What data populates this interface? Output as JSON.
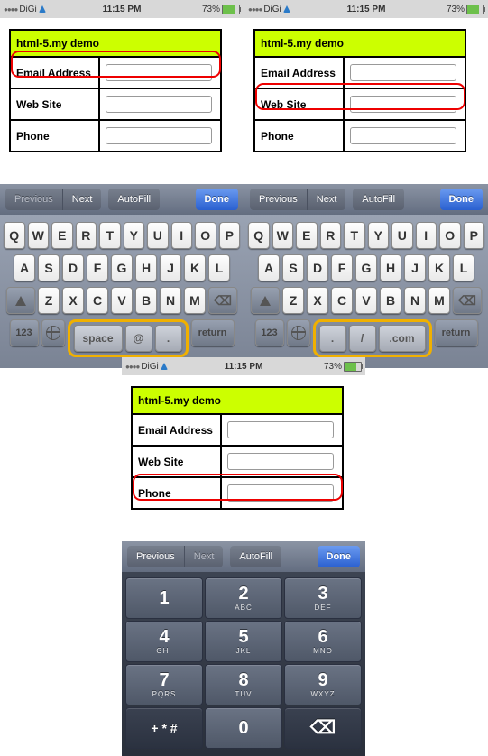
{
  "status": {
    "carrier": "DiGi",
    "time": "11:15 PM",
    "battery_pct": "73%"
  },
  "form": {
    "title": "html-5.my demo",
    "labels": {
      "email": "Email Address",
      "web": "Web Site",
      "phone": "Phone"
    }
  },
  "acc": {
    "prev": "Previous",
    "next": "Next",
    "autofill": "AutoFill",
    "done": "Done"
  },
  "qwerty": {
    "row1": [
      "Q",
      "W",
      "E",
      "R",
      "T",
      "Y",
      "U",
      "I",
      "O",
      "P"
    ],
    "row2": [
      "A",
      "S",
      "D",
      "F",
      "G",
      "H",
      "J",
      "K",
      "L"
    ],
    "row3": [
      "Z",
      "X",
      "C",
      "V",
      "B",
      "N",
      "M"
    ],
    "n123": "123",
    "return": "return"
  },
  "emailKeys": {
    "space": "space",
    "at": "@",
    "dot": "."
  },
  "urlKeys": {
    "dot": ".",
    "slash": "/",
    "com": ".com"
  },
  "numpad": {
    "k1": {
      "n": "1",
      "s": ""
    },
    "k2": {
      "n": "2",
      "s": "ABC"
    },
    "k3": {
      "n": "3",
      "s": "DEF"
    },
    "k4": {
      "n": "4",
      "s": "GHI"
    },
    "k5": {
      "n": "5",
      "s": "JKL"
    },
    "k6": {
      "n": "6",
      "s": "MNO"
    },
    "k7": {
      "n": "7",
      "s": "PQRS"
    },
    "k8": {
      "n": "8",
      "s": "TUV"
    },
    "k9": {
      "n": "9",
      "s": "WXYZ"
    },
    "sym": "+ * #",
    "k0": {
      "n": "0",
      "s": ""
    }
  }
}
